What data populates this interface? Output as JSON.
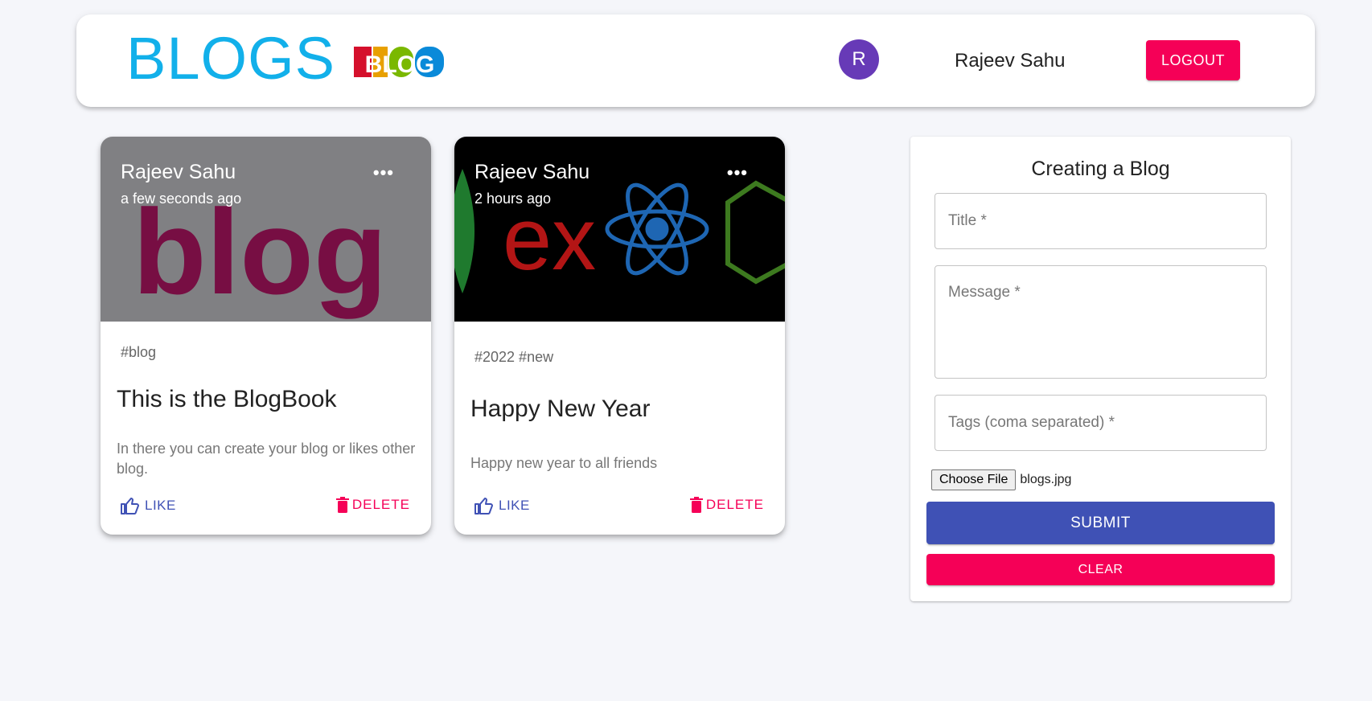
{
  "header": {
    "brand": "BLOGS",
    "logo_text": "BLOG",
    "avatar_initial": "R",
    "user_name": "Rajeev Sahu",
    "logout_label": "LOGOUT"
  },
  "posts": [
    {
      "author": "Rajeev Sahu",
      "time": "a few seconds ago",
      "more_icon": "more-horizontal-icon",
      "image_text": "blog",
      "tags": "#blog",
      "title": "This is the BlogBook",
      "message": "In there you can create your blog or likes other blog.",
      "like_label": "LIKE",
      "delete_label": "DELETE"
    },
    {
      "author": "Rajeev Sahu",
      "time": "2 hours ago",
      "more_icon": "more-horizontal-icon",
      "image_text": "ex",
      "tags": "#2022 #new",
      "title": "Happy New Year",
      "message": "Happy new year to all friends",
      "like_label": "LIKE",
      "delete_label": "DELETE"
    }
  ],
  "form": {
    "heading": "Creating a Blog",
    "title_placeholder": "Title *",
    "message_placeholder": "Message *",
    "tags_placeholder": "Tags (coma separated) *",
    "file_button": "Choose File",
    "file_name": "blogs.jpg",
    "submit_label": "SUBMIT",
    "clear_label": "CLEAR"
  },
  "colors": {
    "brand": "#12b0ea",
    "primary": "#3f51b5",
    "secondary": "#f50057",
    "avatar": "#673ab7"
  }
}
